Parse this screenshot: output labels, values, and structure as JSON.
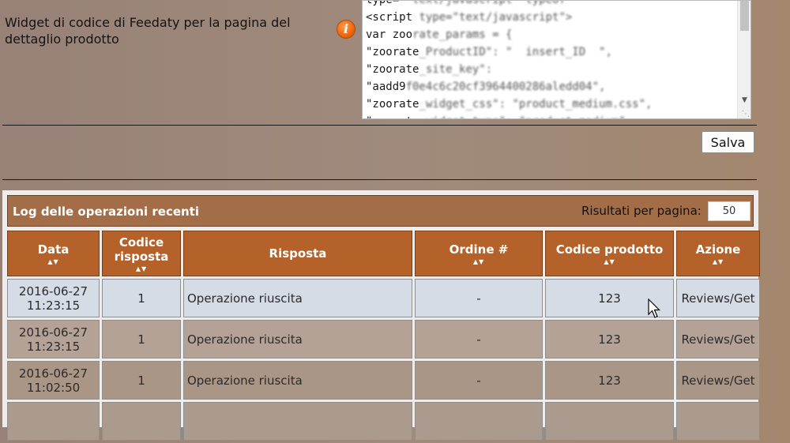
{
  "widget": {
    "label": "Widget di codice di Feedaty per la pagina del dettaglio prodotto",
    "info_icon": "info-icon",
    "code_lines": [
      {
        "a": "type=",
        "b": " \"text/javascript\" typeof"
      },
      {
        "a": "<script",
        "b": " type=\"text/javascript\">"
      },
      {
        "a": "var zoo",
        "b": "rate_params = {"
      },
      {
        "a": "\"zoorate",
        "b": "_ProductID\": \"  insert_ID  \","
      },
      {
        "a": "\"zoorate",
        "b": "_site_key\":"
      },
      {
        "a": "\"aadd9",
        "b": "f0e4c6c20cf3964400286aledd04\","
      },
      {
        "a": "\"zoorate",
        "b": "_widget_css\": \"product_medium.css\","
      },
      {
        "a": "\"zoorate",
        "b": "_widget_type\": \"product_medium\","
      }
    ]
  },
  "save_label": "Salva",
  "log": {
    "title": "Log delle operazioni recenti",
    "per_page_label": "Risultati per pagina:",
    "per_page_value": "50",
    "columns": [
      {
        "label": "Data",
        "sortable": true
      },
      {
        "label": "Codice risposta",
        "sortable": true
      },
      {
        "label": "Risposta",
        "sortable": false
      },
      {
        "label": "Ordine #",
        "sortable": true
      },
      {
        "label": "Codice prodotto",
        "sortable": true
      },
      {
        "label": "Azione",
        "sortable": true
      }
    ],
    "rows": [
      {
        "date": "2016-06-27",
        "time": "11:23:15",
        "code": "1",
        "response": "Operazione riuscita",
        "order": "-",
        "product": "123",
        "action": "Reviews/Get"
      },
      {
        "date": "2016-06-27",
        "time": "11:23:15",
        "code": "1",
        "response": "Operazione riuscita",
        "order": "-",
        "product": "123",
        "action": "Reviews/Get"
      },
      {
        "date": "2016-06-27",
        "time": "11:02:50",
        "code": "1",
        "response": "Operazione riuscita",
        "order": "-",
        "product": "123",
        "action": "Reviews/Get"
      },
      {
        "date": "",
        "time": "",
        "code": "",
        "response": "",
        "order": "",
        "product": "",
        "action": ""
      }
    ]
  },
  "colors": {
    "header_bar": "#a36d48",
    "column_header": "#b4622a",
    "row_highlight": "#d6dce6",
    "info_icon": "#ef6b10"
  },
  "cursor_icon": "mouse-pointer-icon"
}
